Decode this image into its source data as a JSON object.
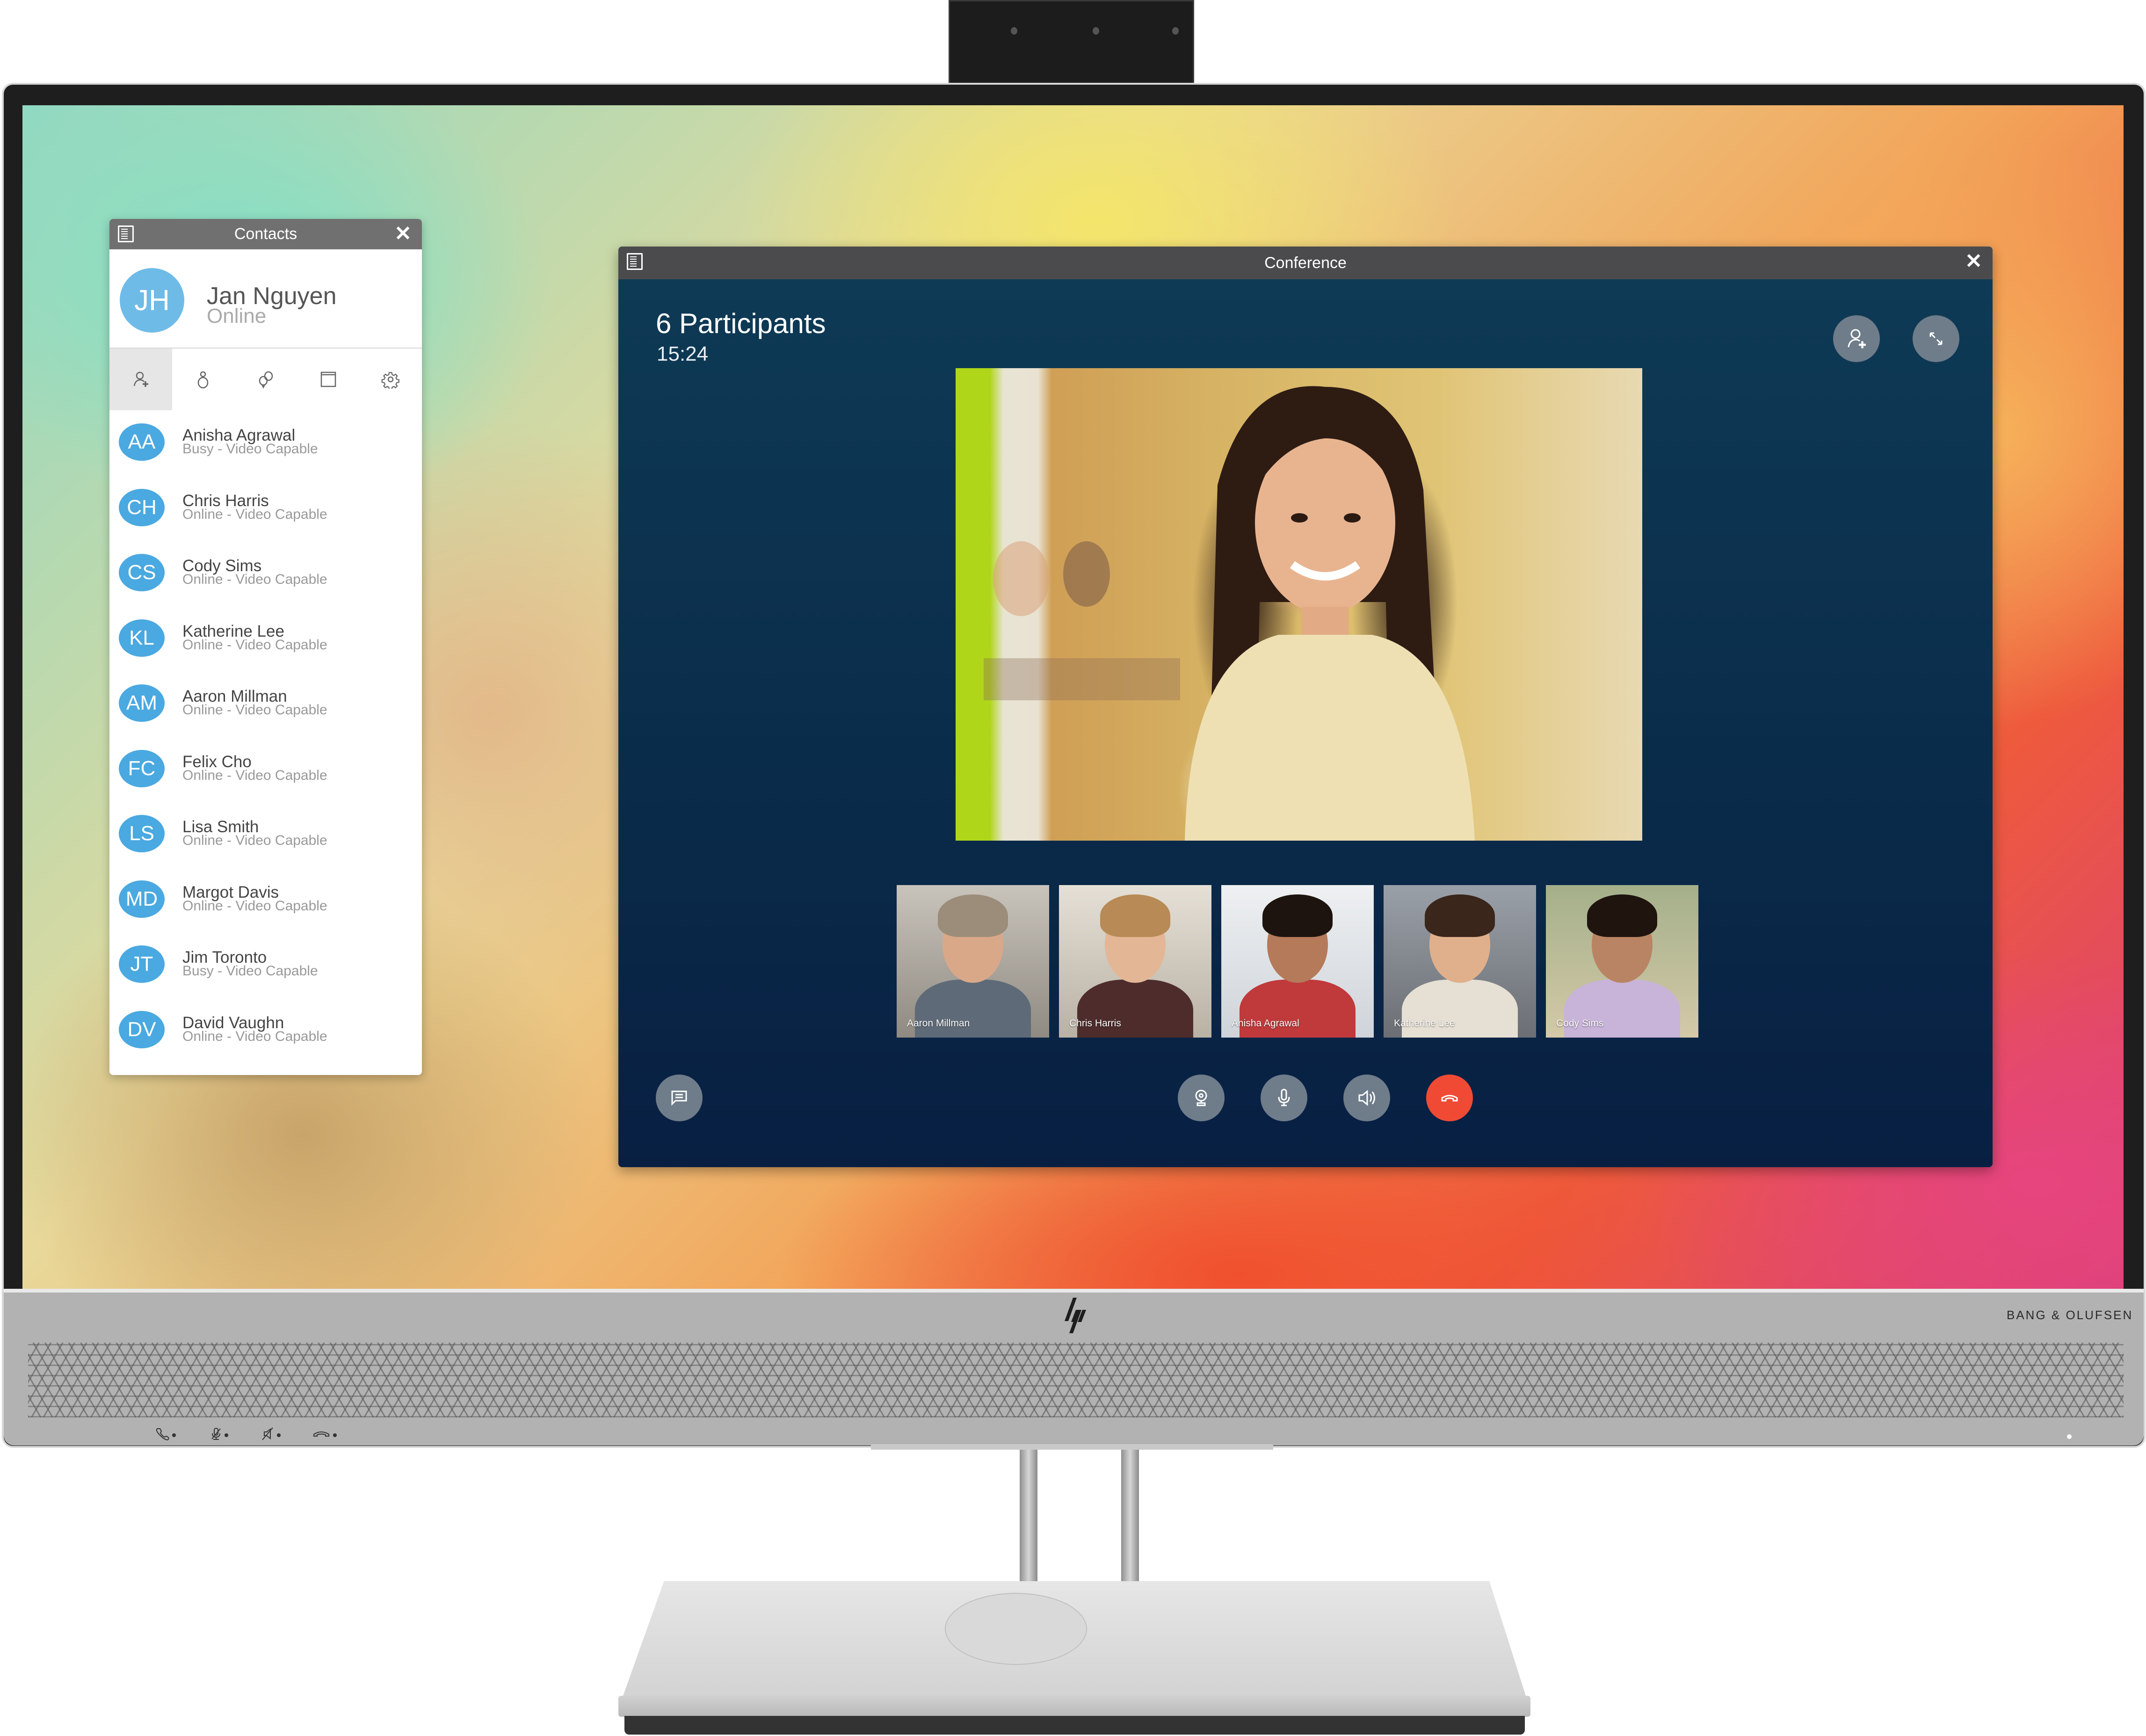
{
  "hardware": {
    "bezel_brand": "BANG & OLUFSEN",
    "bezel_buttons": [
      {
        "icon": "phone-answer-icon"
      },
      {
        "icon": "mic-mute-icon"
      },
      {
        "icon": "speaker-mute-icon"
      },
      {
        "icon": "phone-hangup-icon"
      }
    ]
  },
  "contacts_window": {
    "title": "Contacts",
    "close_label": "✕",
    "profile": {
      "initials": "JH",
      "name": "Jan Nguyen",
      "status": "Online"
    },
    "tabs": [
      {
        "name": "add-contact",
        "icon": "person-add-icon",
        "active": true
      },
      {
        "name": "contacts",
        "icon": "person-icon",
        "active": false
      },
      {
        "name": "chat",
        "icon": "chat-bubbles-icon",
        "active": false
      },
      {
        "name": "window",
        "icon": "window-icon",
        "active": false
      },
      {
        "name": "settings",
        "icon": "gear-icon",
        "active": false
      }
    ],
    "contacts": [
      {
        "initials": "AA",
        "name": "Anisha Agrawal",
        "status": "Busy - Video Capable"
      },
      {
        "initials": "CH",
        "name": "Chris Harris",
        "status": "Online - Video Capable"
      },
      {
        "initials": "CS",
        "name": "Cody Sims",
        "status": "Online - Video Capable"
      },
      {
        "initials": "KL",
        "name": "Katherine Lee",
        "status": "Online - Video Capable"
      },
      {
        "initials": "AM",
        "name": "Aaron Millman",
        "status": "Online - Video Capable"
      },
      {
        "initials": "FC",
        "name": "Felix Cho",
        "status": "Online - Video Capable"
      },
      {
        "initials": "LS",
        "name": "Lisa Smith",
        "status": "Online - Video Capable"
      },
      {
        "initials": "MD",
        "name": "Margot Davis",
        "status": "Online - Video Capable"
      },
      {
        "initials": "JT",
        "name": "Jim Toronto",
        "status": "Busy - Video Capable"
      },
      {
        "initials": "DV",
        "name": "David Vaughn",
        "status": "Online - Video Capable"
      }
    ]
  },
  "conference_window": {
    "title": "Conference",
    "close_label": "✕",
    "participants_label": "6 Participants",
    "duration": "15:24",
    "top_buttons": [
      {
        "name": "add-participant",
        "icon": "person-add-icon"
      },
      {
        "name": "fullscreen",
        "icon": "expand-icon"
      }
    ],
    "thumbnails": [
      {
        "name": "Aaron Millman"
      },
      {
        "name": "Chris Harris"
      },
      {
        "name": "Anisha Agrawal"
      },
      {
        "name": "Katherine Lee"
      },
      {
        "name": "Cody Sims"
      }
    ],
    "controls": [
      {
        "name": "chat",
        "icon": "chat-icon"
      },
      {
        "name": "camera",
        "icon": "webcam-icon"
      },
      {
        "name": "microphone",
        "icon": "microphone-icon"
      },
      {
        "name": "speaker",
        "icon": "speaker-icon"
      },
      {
        "name": "hang-up",
        "icon": "hang-up-icon"
      }
    ]
  },
  "colors": {
    "avatar_blue": "#4aa9e0",
    "profile_avatar_blue": "#6fbbe8",
    "conference_bg": "#0b2f4d",
    "control_gray": "#6f7c8a",
    "hangup_red": "#f04a34",
    "titlebar_gray": "#4b4b4d"
  }
}
